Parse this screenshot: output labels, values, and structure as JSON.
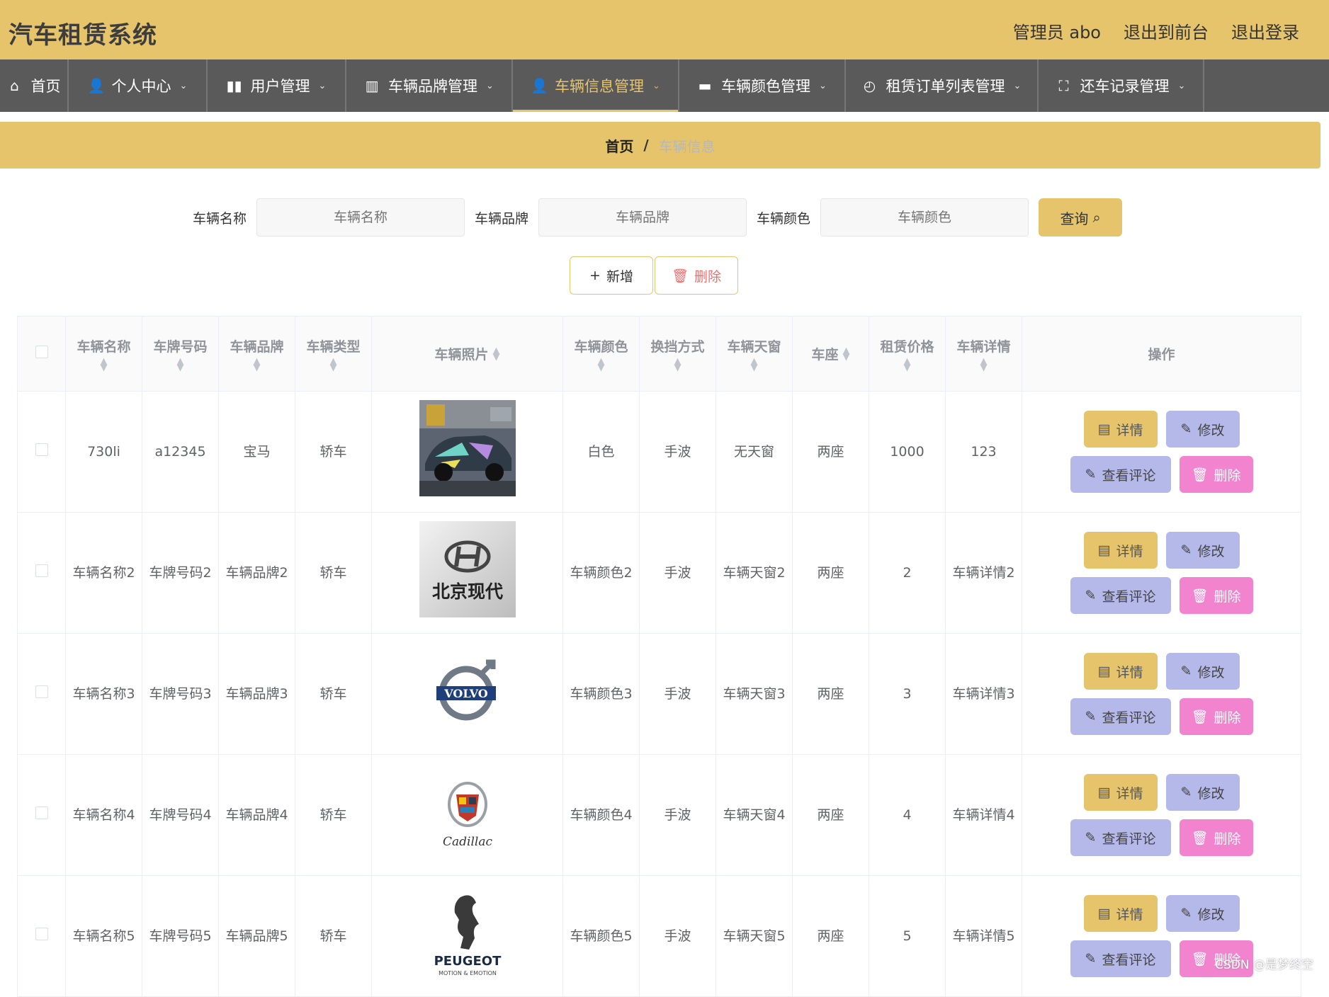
{
  "app": {
    "title": "汽车租赁系统"
  },
  "top_links": {
    "admin": "管理员 abo",
    "frontend": "退出到前台",
    "logout": "退出登录"
  },
  "nav": [
    {
      "label": "首页",
      "icon": "home-icon"
    },
    {
      "label": "个人中心",
      "icon": "user-icon"
    },
    {
      "label": "用户管理",
      "icon": "bar-chart-icon"
    },
    {
      "label": "车辆品牌管理",
      "icon": "book-icon"
    },
    {
      "label": "车辆信息管理",
      "icon": "user-icon"
    },
    {
      "label": "车辆颜色管理",
      "icon": "briefcase-icon"
    },
    {
      "label": "租赁订单列表管理",
      "icon": "compass-icon"
    },
    {
      "label": "还车记录管理",
      "icon": "fullscreen-icon"
    }
  ],
  "breadcrumb": {
    "home": "首页",
    "separator": "/",
    "current": "车辆信息"
  },
  "search": {
    "name_label": "车辆名称",
    "name_placeholder": "车辆名称",
    "brand_label": "车辆品牌",
    "brand_placeholder": "车辆品牌",
    "color_label": "车辆颜色",
    "color_placeholder": "车辆颜色",
    "query_label": "查询"
  },
  "actions": {
    "add": "新增",
    "delete": "删除"
  },
  "table": {
    "headers": [
      "车辆名称",
      "车牌号码",
      "车辆品牌",
      "车辆类型",
      "车辆照片",
      "车辆颜色",
      "换挡方式",
      "车辆天窗",
      "车座",
      "租赁价格",
      "车辆详情",
      "操作"
    ],
    "row_buttons": {
      "detail": "详情",
      "edit": "修改",
      "comment": "查看评论",
      "delete": "删除"
    },
    "rows": [
      {
        "name": "730li",
        "plate": "a12345",
        "brand": "宝马",
        "type": "轿车",
        "photo": "race-car-photo",
        "color": "白色",
        "gear": "手波",
        "sunroof": "无天窗",
        "seats": "两座",
        "price": "1000",
        "detail": "123"
      },
      {
        "name": "车辆名称2",
        "plate": "车牌号码2",
        "brand": "车辆品牌2",
        "type": "轿车",
        "photo": "beijing-hyundai-logo",
        "photo_text": "北京现代",
        "color": "车辆颜色2",
        "gear": "手波",
        "sunroof": "车辆天窗2",
        "seats": "两座",
        "price": "2",
        "detail": "车辆详情2"
      },
      {
        "name": "车辆名称3",
        "plate": "车牌号码3",
        "brand": "车辆品牌3",
        "type": "轿车",
        "photo": "volvo-logo",
        "photo_text": "VOLVO",
        "color": "车辆颜色3",
        "gear": "手波",
        "sunroof": "车辆天窗3",
        "seats": "两座",
        "price": "3",
        "detail": "车辆详情3"
      },
      {
        "name": "车辆名称4",
        "plate": "车牌号码4",
        "brand": "车辆品牌4",
        "type": "轿车",
        "photo": "cadillac-logo",
        "photo_text": "Cadillac",
        "color": "车辆颜色4",
        "gear": "手波",
        "sunroof": "车辆天窗4",
        "seats": "两座",
        "price": "4",
        "detail": "车辆详情4"
      },
      {
        "name": "车辆名称5",
        "plate": "车牌号码5",
        "brand": "车辆品牌5",
        "type": "轿车",
        "photo": "peugeot-logo",
        "photo_text": "PEUGEOT",
        "photo_subtext": "MOTION & EMOTION",
        "color": "车辆颜色5",
        "gear": "手波",
        "sunroof": "车辆天窗5",
        "seats": "两座",
        "price": "5",
        "detail": "车辆详情5"
      }
    ]
  },
  "watermark": "CSDN @是梦终空",
  "colors": {
    "accent": "#e6c46c",
    "nav_bg": "#5a5a5a",
    "button_purple": "#b5b9ea",
    "button_pink": "#f283cf"
  }
}
